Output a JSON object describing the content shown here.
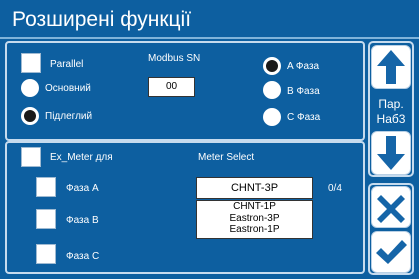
{
  "header": {
    "title": "Розширені функції"
  },
  "top": {
    "parallel_label": "Parallel",
    "master_label": "Основний",
    "slave_label": "Підлеглий",
    "modbus_label": "Modbus SN",
    "modbus_value": "00",
    "phase_a_label": "A Фаза",
    "phase_b_label": "B Фаза",
    "phase_c_label": "C Фаза",
    "selected_role": "slave",
    "selected_phase": "A"
  },
  "bottom": {
    "ex_meter_label": "Ex_Meter для",
    "meter_select_label": "Meter Select",
    "phase_a_label": "Фаза A",
    "phase_b_label": "Фаза B",
    "phase_c_label": "Фаза C",
    "meter_selected": "CHNT-3P",
    "meter_count": "0/4",
    "meter_options": [
      "CHNT-1P",
      "Eastron-3P",
      "Eastron-1P"
    ]
  },
  "side": {
    "page_label_line1": "Пар.",
    "page_label_line2": "Наб3"
  },
  "colors": {
    "background": "#0d5fa0",
    "button_icon": "#1565a8",
    "border": "#c6dbee"
  }
}
